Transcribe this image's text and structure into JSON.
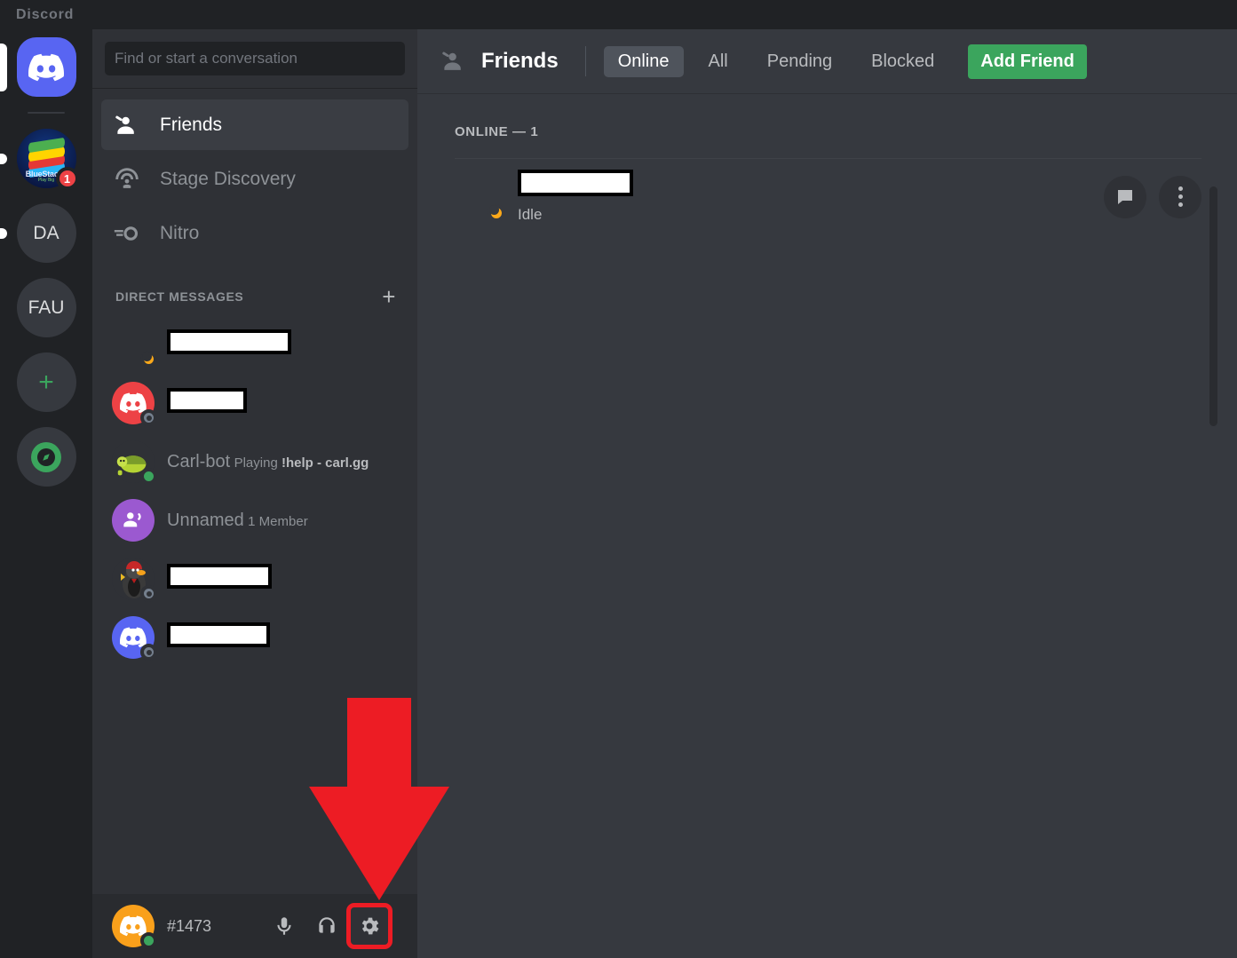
{
  "window": {
    "title": "Discord"
  },
  "colors": {
    "brand_blurple": "#5865f2",
    "green_accent": "#3ba55d",
    "red_badge": "#ed4245",
    "annotation_red": "#ed1c24",
    "idle_yellow": "#faa81a",
    "sidebar_bg": "#2f3136",
    "main_bg": "#36393f",
    "rail_bg": "#202225"
  },
  "server_rail": {
    "items": [
      {
        "name": "home-discord",
        "label": "",
        "icon": "discord-logo-icon",
        "selected": true,
        "indicator": "selected"
      },
      {
        "name": "bluestacks",
        "label": "BlueStacks",
        "sublabel": "Play Big",
        "icon": "bluestacks-icon",
        "badge": "1",
        "indicator": "unread"
      },
      {
        "name": "server-da",
        "label": "DA",
        "icon": "server-initials-icon",
        "indicator": "unread"
      },
      {
        "name": "server-fau",
        "label": "FAU",
        "icon": "server-initials-icon",
        "indicator": "none"
      },
      {
        "name": "add-server",
        "label": "+",
        "icon": "plus-icon",
        "indicator": "none"
      },
      {
        "name": "explore-servers",
        "label": "",
        "icon": "compass-icon",
        "indicator": "none"
      }
    ]
  },
  "search": {
    "placeholder": "Find or start a conversation"
  },
  "sidebar": {
    "nav": [
      {
        "label": "Friends",
        "icon": "friends-icon",
        "active": true
      },
      {
        "label": "Stage Discovery",
        "icon": "stage-icon",
        "active": false
      },
      {
        "label": "Nitro",
        "icon": "nitro-icon",
        "active": false
      }
    ],
    "dm_header": {
      "label": "DIRECT MESSAGES",
      "add_icon": "plus-icon",
      "add_label": "+"
    },
    "dms": [
      {
        "name": "",
        "redacted": true,
        "redact_width": 140,
        "sub": "",
        "status": "idle",
        "avatar": "galaxy"
      },
      {
        "name": "",
        "redacted": true,
        "redact_width": 90,
        "sub": "",
        "status": "offline",
        "avatar": "discord-red"
      },
      {
        "name": "Carl-bot",
        "redacted": false,
        "sub_prefix": "Playing ",
        "sub_bold": "!help - carl.gg",
        "status": "online",
        "avatar": "turtle"
      },
      {
        "name": "Unnamed",
        "redacted": false,
        "sub": "1 Member",
        "status": "none",
        "avatar": "group"
      },
      {
        "name": "",
        "redacted": true,
        "redact_width": 118,
        "sub": "",
        "status": "offline",
        "avatar": "penguin"
      },
      {
        "name": "",
        "redacted": true,
        "redact_width": 116,
        "sub": "",
        "status": "offline",
        "avatar": "discord-blue"
      }
    ]
  },
  "user_panel": {
    "username_redacted": true,
    "discriminator": "#1473",
    "status": "online",
    "controls": [
      {
        "name": "mute-microphone-button",
        "icon": "microphone-icon",
        "highlighted": false
      },
      {
        "name": "deafen-button",
        "icon": "headphones-icon",
        "highlighted": false
      },
      {
        "name": "user-settings-button",
        "icon": "gear-icon",
        "highlighted": true
      }
    ]
  },
  "main": {
    "header": {
      "icon": "friends-icon",
      "title": "Friends",
      "tabs": [
        {
          "label": "Online",
          "active": true
        },
        {
          "label": "All",
          "active": false
        },
        {
          "label": "Pending",
          "active": false
        },
        {
          "label": "Blocked",
          "active": false
        }
      ],
      "add_friend_label": "Add Friend"
    },
    "section_label": "ONLINE — 1",
    "friends": [
      {
        "name": "",
        "redacted": true,
        "redact_width": 130,
        "status_text": "Idle",
        "status": "idle",
        "avatar": "galaxy",
        "actions": [
          {
            "name": "message-button",
            "icon": "message-icon"
          },
          {
            "name": "more-options-button",
            "icon": "more-vertical-icon"
          }
        ]
      }
    ]
  },
  "annotation": {
    "type": "arrow-down",
    "color": "#ed1c24",
    "points_to": "user-settings-button"
  }
}
